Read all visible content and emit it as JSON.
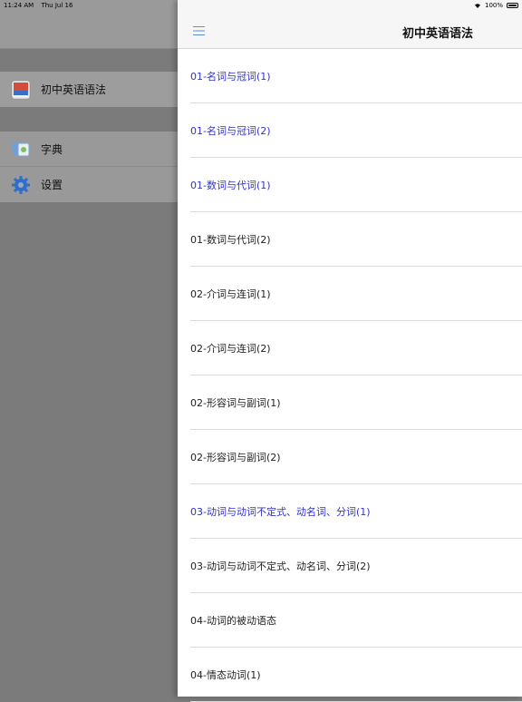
{
  "status_bar": {
    "time": "11:24 AM",
    "date": "Thu Jul 16",
    "battery": "100%"
  },
  "sidebar": {
    "app_item": {
      "label": "初中英语语法",
      "icon": "app-book-icon"
    },
    "items": [
      {
        "label": "字典",
        "icon": "dictionary-icon"
      },
      {
        "label": "设置",
        "icon": "gear-icon"
      }
    ]
  },
  "nav": {
    "title": "初中英语语法",
    "menu_icon": "hamburger-icon"
  },
  "colors": {
    "visited_link": "#3232c8",
    "text": "#222222"
  },
  "list": [
    {
      "title": "01-名词与冠词(1)",
      "visited": true
    },
    {
      "title": "01-名词与冠词(2)",
      "visited": true
    },
    {
      "title": "01-数词与代词(1)",
      "visited": true
    },
    {
      "title": "01-数词与代词(2)",
      "visited": false
    },
    {
      "title": "02-介词与连词(1)",
      "visited": false
    },
    {
      "title": "02-介词与连词(2)",
      "visited": false
    },
    {
      "title": "02-形容词与副词(1)",
      "visited": false
    },
    {
      "title": "02-形容词与副词(2)",
      "visited": false
    },
    {
      "title": "03-动词与动词不定式、动名词、分词(1)",
      "visited": true
    },
    {
      "title": "03-动词与动词不定式、动名词、分词(2)",
      "visited": false
    },
    {
      "title": "04-动词的被动语态",
      "visited": false
    },
    {
      "title": "04-情态动词(1)",
      "visited": false
    }
  ]
}
